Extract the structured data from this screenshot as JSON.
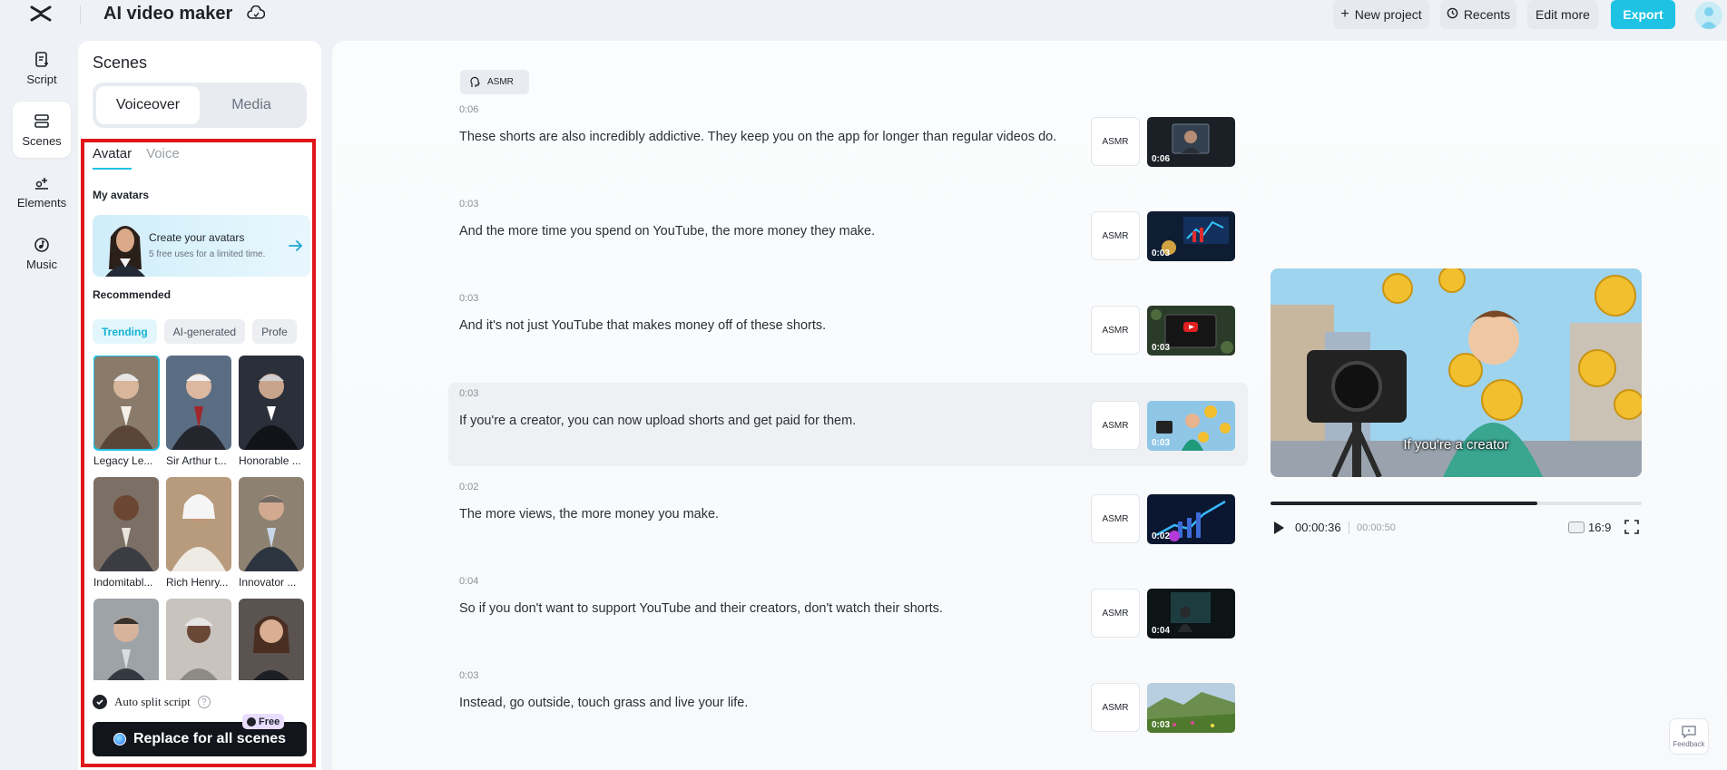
{
  "header": {
    "title": "AI video maker",
    "buttons": {
      "new_project": "New project",
      "recents": "Recents",
      "edit_more": "Edit more",
      "export": "Export"
    }
  },
  "rail": {
    "items": [
      {
        "label": "Script",
        "icon": "script-icon"
      },
      {
        "label": "Scenes",
        "icon": "scenes-icon",
        "active": true
      },
      {
        "label": "Elements",
        "icon": "elements-icon"
      },
      {
        "label": "Music",
        "icon": "music-icon"
      }
    ]
  },
  "scenes_panel": {
    "title": "Scenes",
    "segments": [
      "Voiceover",
      "Media"
    ],
    "active_segment": "Voiceover",
    "sub_tabs": [
      "Avatar",
      "Voice"
    ],
    "active_sub_tab": "Avatar",
    "my_avatars_label": "My avatars",
    "create_card": {
      "title": "Create your avatars",
      "subtitle": "5 free uses for a limited time."
    },
    "recommended_label": "Recommended",
    "chips": [
      "Trending",
      "AI-generated",
      "Profe"
    ],
    "active_chip": "Trending",
    "avatars": [
      {
        "name": "Legacy Le...",
        "selected": true
      },
      {
        "name": "Sir Arthur t..."
      },
      {
        "name": "Honorable ..."
      },
      {
        "name": "Indomitabl..."
      },
      {
        "name": "Rich Henry..."
      },
      {
        "name": "Innovator ..."
      },
      {
        "name": ""
      },
      {
        "name": ""
      },
      {
        "name": ""
      }
    ],
    "auto_split_label": "Auto split script",
    "auto_split_checked": true,
    "replace_button": "Replace for all scenes",
    "free_badge": "Free"
  },
  "script": {
    "voice_tag": "ASMR",
    "scenes": [
      {
        "time": "0:06",
        "text": "These shorts are also incredibly addictive. They keep you on the app for longer than regular videos do.",
        "voice": "ASMR",
        "duration": "0:06"
      },
      {
        "time": "0:03",
        "text": "And the more time you spend on YouTube, the more money they make.",
        "voice": "ASMR",
        "duration": "0:03"
      },
      {
        "time": "0:03",
        "text": "And it's not just YouTube that makes money off of these shorts.",
        "voice": "ASMR",
        "duration": "0:03"
      },
      {
        "time": "0:03",
        "text": "If you're a creator, you can now upload shorts and get paid for them.",
        "voice": "ASMR",
        "duration": "0:03",
        "highlighted": true
      },
      {
        "time": "0:02",
        "text": "The more views, the more money you make.",
        "voice": "ASMR",
        "duration": "0:02"
      },
      {
        "time": "0:04",
        "text": "So if you don't want to support YouTube and their creators, don't watch their shorts.",
        "voice": "ASMR",
        "duration": "0:04"
      },
      {
        "time": "0:03",
        "text": "Instead, go outside, touch grass and live your life.",
        "voice": "ASMR",
        "duration": "0:03"
      }
    ]
  },
  "preview": {
    "subtitle": "If you're a creator",
    "current_time": "00:00:36",
    "total_time": "00:00:50",
    "progress": 0.72,
    "aspect_ratio": "16:9"
  },
  "feedback_label": "Feedback",
  "colors": {
    "accent": "#1ec3e3",
    "highlight_frame": "#e0161c",
    "dark_button": "#12151b"
  }
}
